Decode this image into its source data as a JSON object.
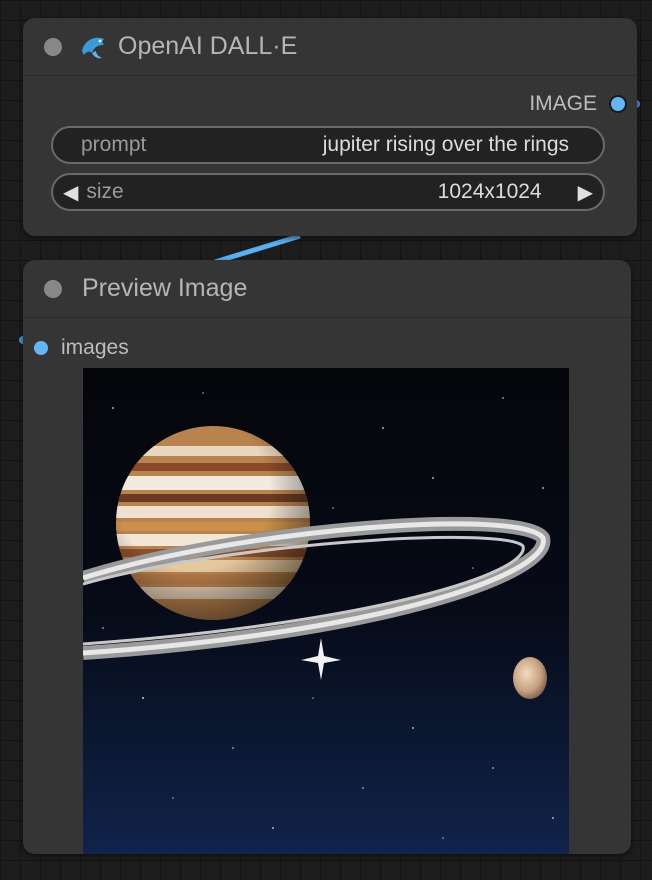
{
  "nodes": {
    "dalle": {
      "title": "OpenAI DALL·E",
      "icon": "dolphin-icon",
      "output_label": "IMAGE",
      "prompt": {
        "label": "prompt",
        "value": "jupiter rising over the rings"
      },
      "size": {
        "label": "size",
        "value": "1024x1024"
      }
    },
    "preview": {
      "title": "Preview Image",
      "input_label": "images",
      "image": "jupiter-rising-over-rings-render"
    }
  },
  "colors": {
    "canvas": "#1d1d1d",
    "node_body": "#353535",
    "slot_image": "#64b5f6",
    "link": "#64b5f6"
  }
}
